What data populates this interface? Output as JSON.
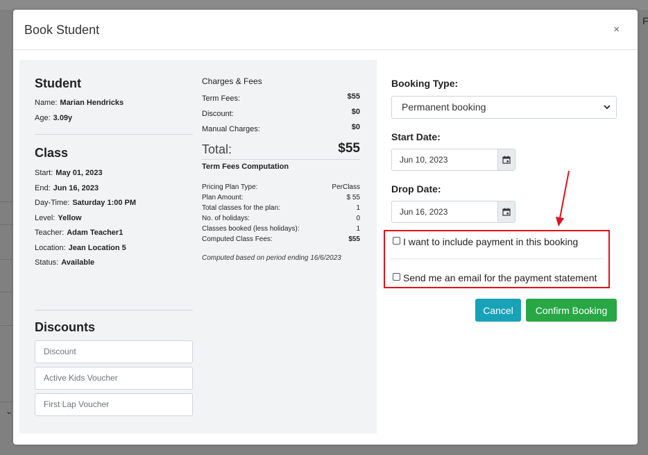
{
  "backdrop": {
    "right_letter": "F"
  },
  "modal": {
    "title": "Book Student",
    "close_glyph": "×"
  },
  "student": {
    "heading": "Student",
    "fields": [
      {
        "label": "Name:",
        "value": "Marian Hendricks"
      },
      {
        "label": "Age:",
        "value": "3.09y"
      }
    ]
  },
  "class": {
    "heading": "Class",
    "fields": [
      {
        "label": "Start:",
        "value": "May 01, 2023"
      },
      {
        "label": "End:",
        "value": "Jun 16, 2023"
      },
      {
        "label": "Day-Time:",
        "value": "Saturday 1:00 PM"
      },
      {
        "label": "Level:",
        "value": "Yellow"
      },
      {
        "label": "Teacher:",
        "value": "Adam Teacher1"
      },
      {
        "label": "Location:",
        "value": "Jean Location 5"
      },
      {
        "label": "Status:",
        "value": "Available"
      }
    ]
  },
  "discounts": {
    "heading": "Discounts",
    "placeholders": [
      "Discount",
      "Active Kids Voucher",
      "First Lap Voucher"
    ]
  },
  "charges": {
    "heading": "Charges & Fees",
    "rows": [
      {
        "label": "Term Fees:",
        "amount": "$55"
      },
      {
        "label": "Discount:",
        "amount": "$0"
      },
      {
        "label": "Manual Charges:",
        "amount": "$0"
      }
    ],
    "total_label": "Total:",
    "total_amount": "$55",
    "computation_heading": "Term Fees Computation",
    "computation_rows": [
      {
        "label": "Pricing Plan Type:",
        "value": "PerClass"
      },
      {
        "label": "Plan Amount:",
        "value": "$ 55"
      },
      {
        "label": "Total classes for the plan:",
        "value": "1"
      },
      {
        "label": "No. of holidays:",
        "value": "0"
      },
      {
        "label": "Classes booked (less holidays):",
        "value": "1"
      },
      {
        "label": "Computed Class Fees:",
        "value": "$55"
      }
    ],
    "note": "Computed based on period ending 16/6/2023"
  },
  "form": {
    "booking_type_label": "Booking Type:",
    "booking_type_value": "Permanent booking",
    "start_date_label": "Start Date:",
    "start_date_value": "Jun 10, 2023",
    "drop_date_label": "Drop Date:",
    "drop_date_value": "Jun 16, 2023",
    "checkbox_payment": "I want to include payment in this booking",
    "checkbox_email": "Send me an email for the payment statement",
    "cancel_label": "Cancel",
    "confirm_label": "Confirm Booking"
  },
  "colors": {
    "cancel": "#17a2b8",
    "confirm": "#28a745",
    "annotation_red": "#e0101c"
  },
  "icons": [
    "close-icon",
    "chevron-down-icon",
    "calendar-icon",
    "annotation-arrow"
  ]
}
